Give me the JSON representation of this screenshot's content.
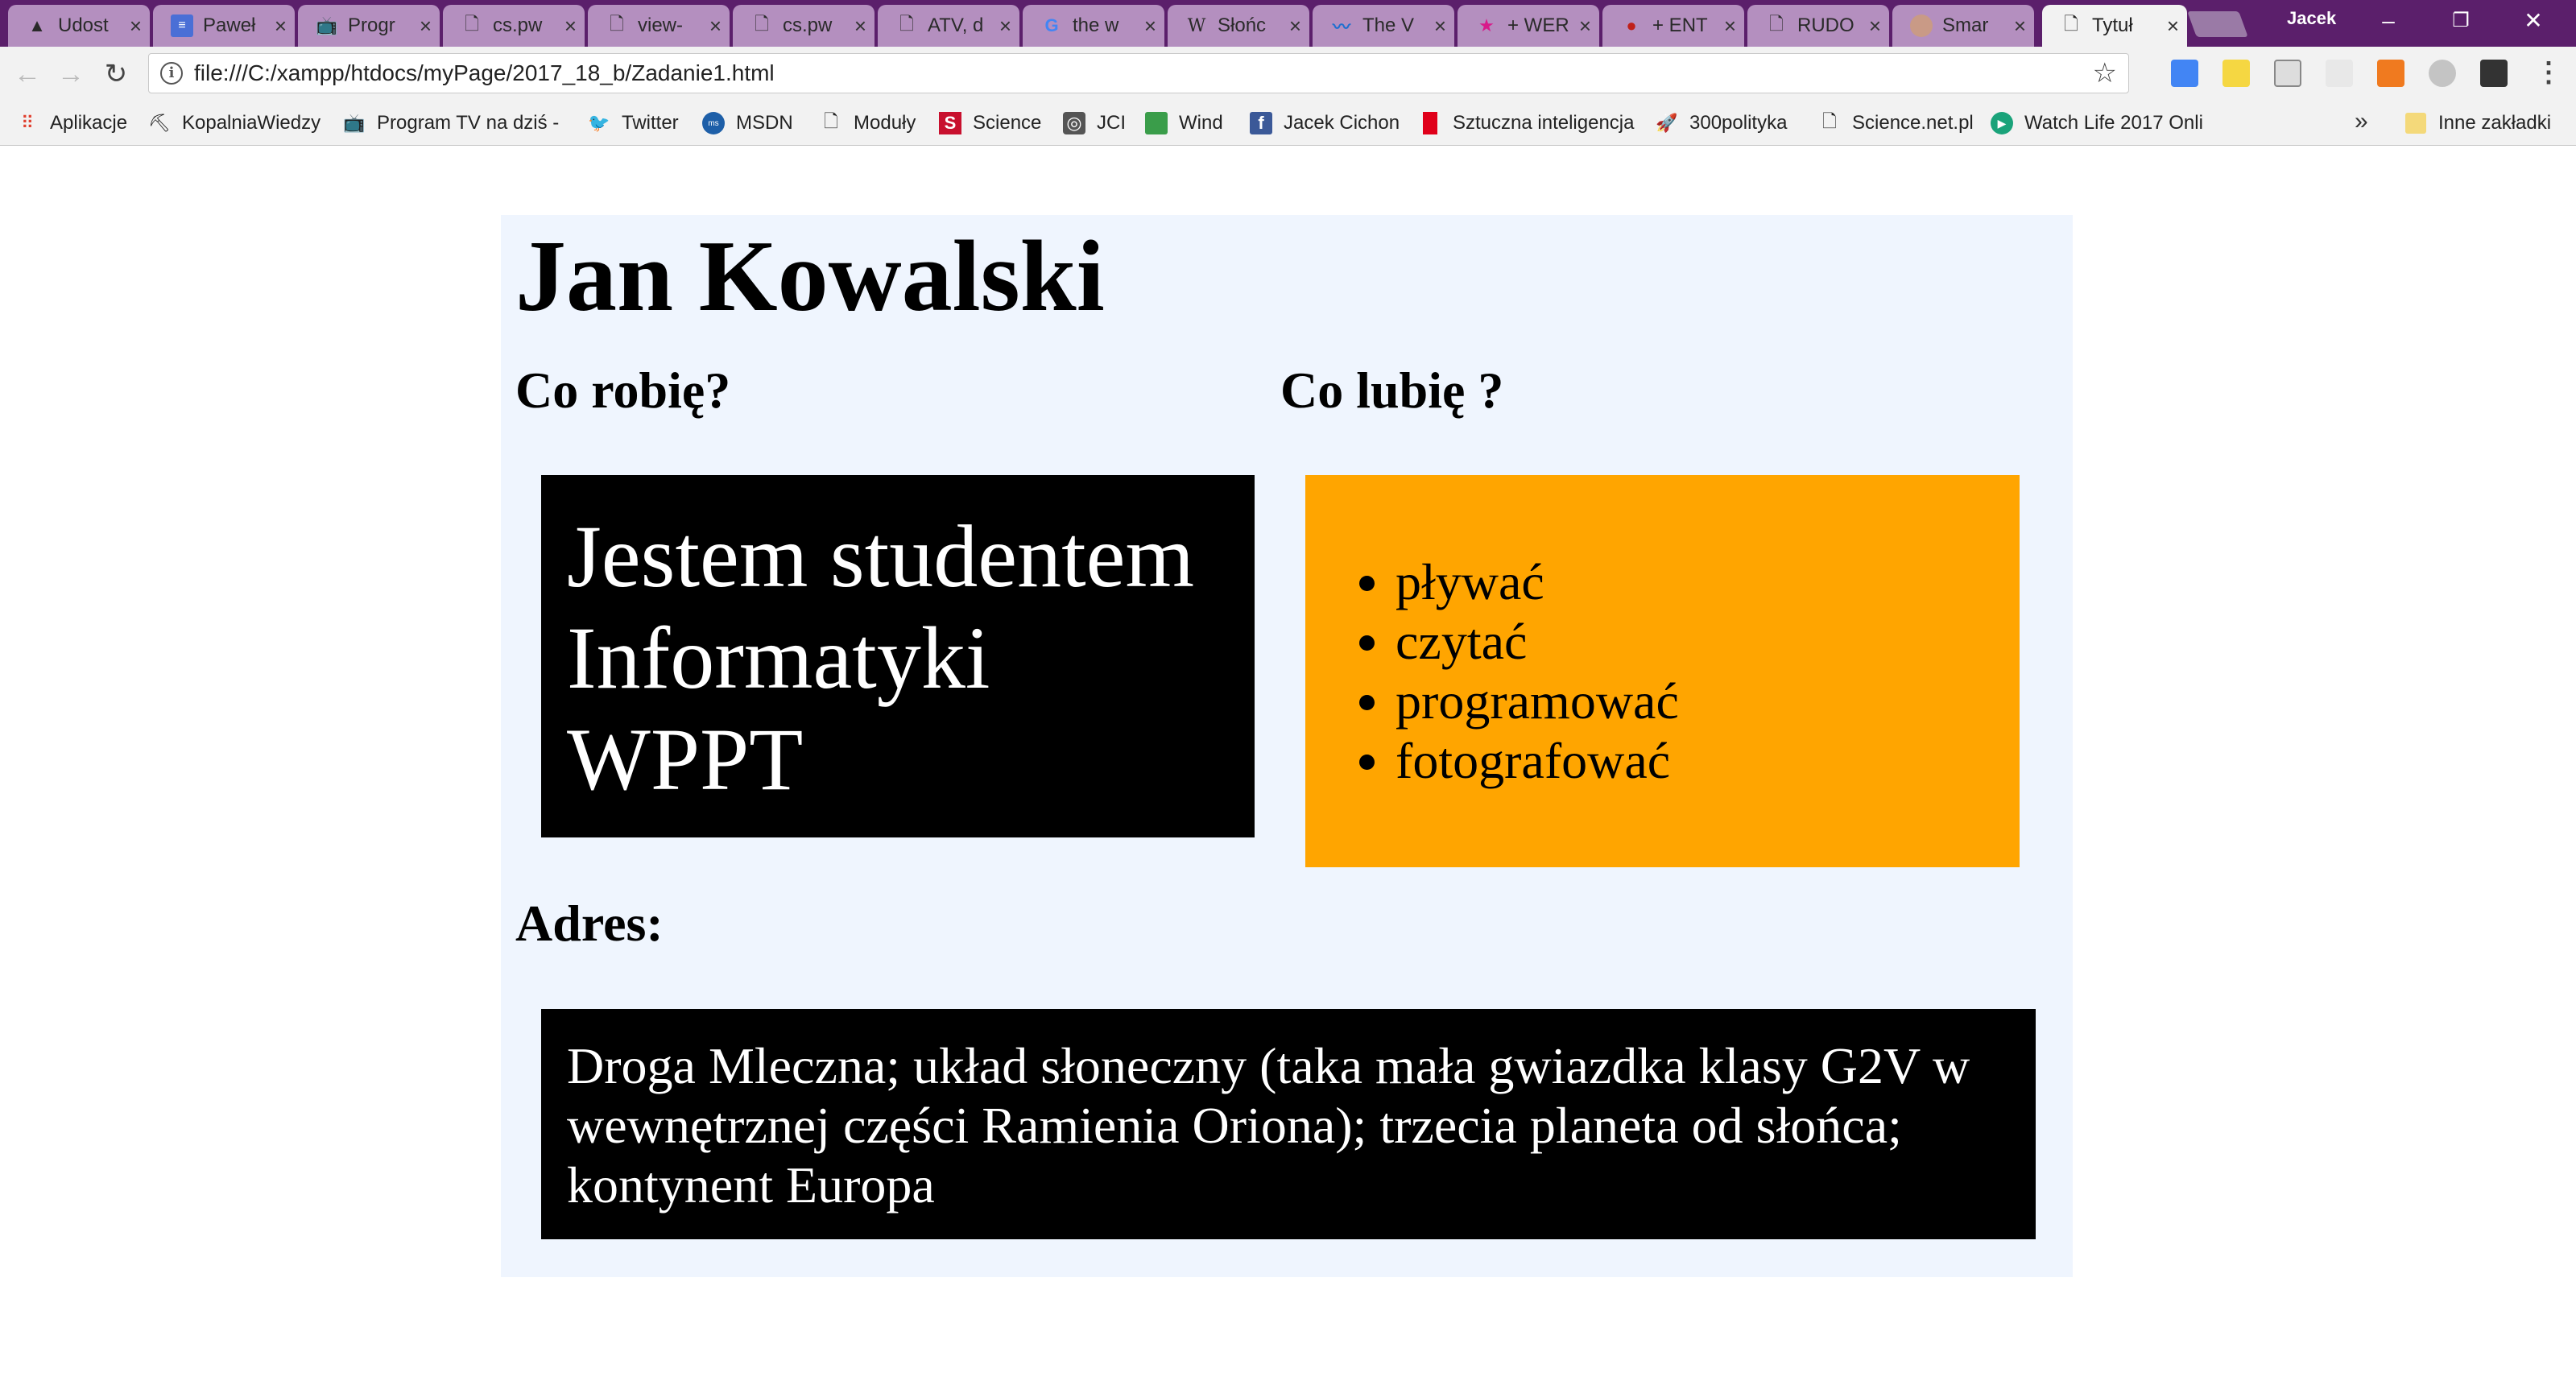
{
  "browser": {
    "tabs": [
      {
        "label": "Udost",
        "icon": "google-drive-icon"
      },
      {
        "label": "Paweł",
        "icon": "google-docs-icon"
      },
      {
        "label": "Progr",
        "icon": "tv-icon"
      },
      {
        "label": "cs.pw",
        "icon": "page-icon"
      },
      {
        "label": "view-",
        "icon": "page-icon"
      },
      {
        "label": "cs.pw",
        "icon": "page-icon"
      },
      {
        "label": "ATV, d",
        "icon": "page-icon"
      },
      {
        "label": "the w",
        "icon": "google-icon"
      },
      {
        "label": "Słońc",
        "icon": "wikipedia-icon"
      },
      {
        "label": "The V",
        "icon": "wave-icon"
      },
      {
        "label": "+ WER",
        "icon": "star-icon"
      },
      {
        "label": "+ ENT",
        "icon": "shield-icon"
      },
      {
        "label": "RUDO",
        "icon": "page-icon"
      },
      {
        "label": "Smar",
        "icon": "avatar-icon"
      },
      {
        "label": "Tytuł",
        "icon": "page-icon"
      }
    ],
    "profile_name": "Jacek",
    "url": "file:///C:/xampp/htdocs/myPage/2017_18_b/Zadanie1.html",
    "bookmarks": [
      {
        "label": "Aplikacje",
        "icon": "apps-grid-icon"
      },
      {
        "label": "KopalniaWiedzy",
        "icon": "kopalnia-icon"
      },
      {
        "label": "Program TV na dziś -",
        "icon": "tv-icon"
      },
      {
        "label": "Twitter",
        "icon": "twitter-icon"
      },
      {
        "label": "MSDN",
        "icon": "msdn-icon"
      },
      {
        "label": "Moduły",
        "icon": "page-icon"
      },
      {
        "label": "Science",
        "icon": "science-icon"
      },
      {
        "label": "JCI",
        "icon": "jci-icon"
      },
      {
        "label": "Wind",
        "icon": "wind-icon"
      },
      {
        "label": "Jacek Cichon",
        "icon": "facebook-icon"
      },
      {
        "label": "Sztuczna inteligencja",
        "icon": "red-flag-icon"
      },
      {
        "label": "300polityka",
        "icon": "rocket-icon"
      },
      {
        "label": "Science.net.pl",
        "icon": "page-icon"
      },
      {
        "label": "Watch Life 2017 Onli",
        "icon": "play-icon"
      }
    ],
    "other_bookmarks": "Inne zakładki"
  },
  "page": {
    "title": "Jan Kowalski",
    "what_i_do_heading": "Co robię?",
    "what_i_do_text": "Jestem studentem Informatyki WPPT",
    "what_i_like_heading": "Co lubię ?",
    "likes": [
      "pływać",
      "czytać",
      "programować",
      "fotografować"
    ],
    "address_heading": "Adres:",
    "address_text": "Droga Mleczna; układ słoneczny (taka mała gwiazdka klasy G2V w wewnętrznej części Ramienia Oriona); trzecia planeta od słońca; kontynent Europa"
  },
  "colors": {
    "content_bg": "#eff5fe",
    "black_box": "#000000",
    "orange_box": "#ffa500",
    "tabstrip": "#5b1f6b"
  }
}
